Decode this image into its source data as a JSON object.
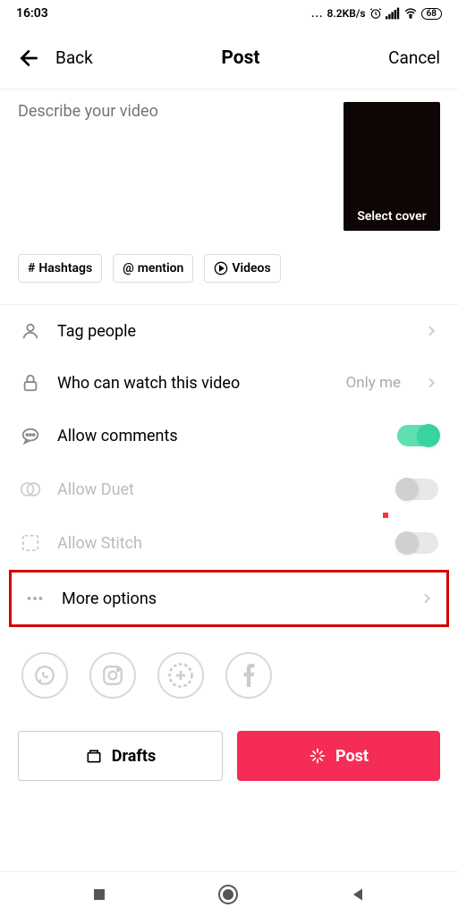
{
  "status": {
    "time": "16:03",
    "data_rate": "8.2KB/s",
    "battery": "68"
  },
  "nav": {
    "back": "Back",
    "title": "Post",
    "cancel": "Cancel"
  },
  "compose": {
    "placeholder": "Describe your video",
    "cover_label": "Select cover"
  },
  "chips": {
    "hashtags": "Hashtags",
    "mention": "mention",
    "videos": "Videos"
  },
  "settings": {
    "tag_people": "Tag people",
    "privacy_label": "Who can watch this video",
    "privacy_value": "Only me",
    "comments": "Allow comments",
    "duet": "Allow Duet",
    "stitch": "Allow Stitch",
    "more": "More options"
  },
  "actions": {
    "drafts": "Drafts",
    "post": "Post"
  }
}
